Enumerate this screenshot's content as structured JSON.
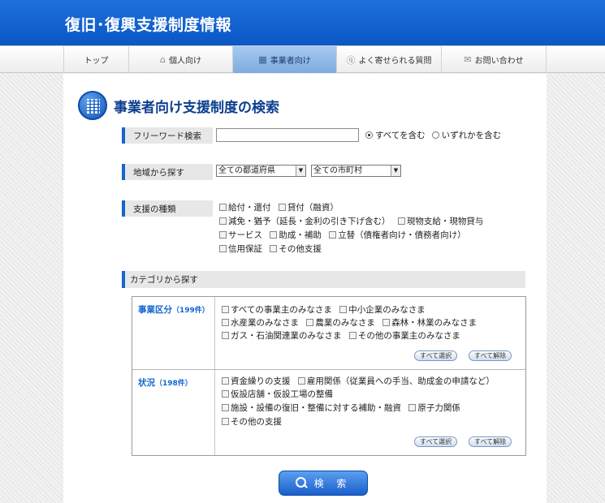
{
  "header": {
    "title": "復旧･復興支援制度情報"
  },
  "nav": {
    "items": [
      {
        "label": "トップ",
        "icon": ""
      },
      {
        "label": "個人向け",
        "icon": "house-icon"
      },
      {
        "label": "事業者向け",
        "icon": "building-icon"
      },
      {
        "label": "よく寄せられる質問",
        "icon": "question-icon"
      },
      {
        "label": "お問い合わせ",
        "icon": "mail-icon"
      }
    ],
    "active": "事業者向け"
  },
  "page": {
    "title": "事業者向け支援制度の検索"
  },
  "freeword": {
    "label": "フリーワード検索",
    "value": "",
    "radio_all": "すべてを含む",
    "radio_any": "いずれかを含む",
    "selected": "すべてを含む"
  },
  "region": {
    "label": "地域から探す",
    "prefecture": "全ての都道府県",
    "city": "全ての市町村"
  },
  "support_type": {
    "label": "支援の種類",
    "options": [
      "給付・還付",
      "貸付（融資）",
      "減免・猶予（延長・金利の引き下げ含む）",
      "現物支給・現物貸与",
      "サービス",
      "助成・補助",
      "立替（債権者向け・債務者向け）",
      "信用保証",
      "その他支援"
    ]
  },
  "category": {
    "label": "カテゴリから探す",
    "business": {
      "title": "事業区分",
      "count": "（199件）",
      "options": [
        "すべての事業主のみなさま",
        "中小企業のみなさま",
        "水産業のみなさま",
        "農業のみなさま",
        "森林・林業のみなさま",
        "ガス・石油関連業のみなさま",
        "その他の事業主のみなさま"
      ]
    },
    "status": {
      "title": "状況",
      "count": "（198件）",
      "options": [
        "資金繰りの支援",
        "雇用関係（従業員への手当、助成金の申請など）",
        "仮設店舗・仮設工場の整備",
        "施設・設備の復旧・整備に対する補助・融資",
        "原子力関係",
        "その他の支援"
      ]
    },
    "select_all": "すべて選択",
    "deselect_all": "すべて解除"
  },
  "search_button": "検 索",
  "colors": {
    "header_blue": "#0a57c6",
    "accent_blue": "#1565d0",
    "nav_active": "#7eabe0"
  }
}
